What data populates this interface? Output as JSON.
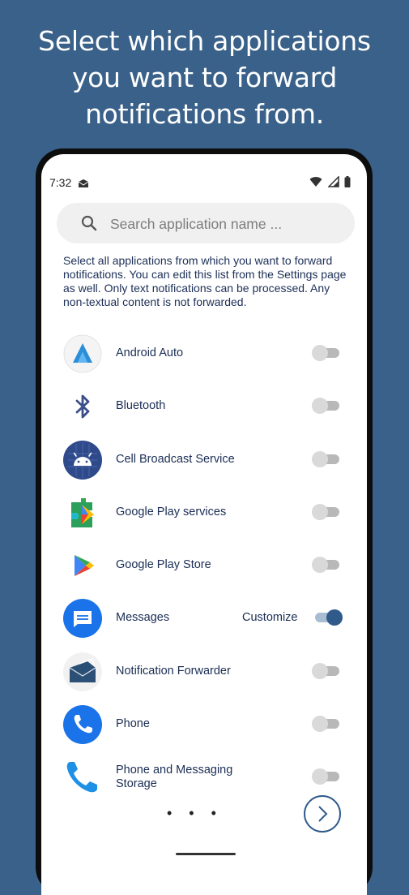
{
  "headline": {
    "line1": "Select which applications",
    "line2": "you want to forward",
    "line3": "notifications from."
  },
  "status_bar": {
    "time": "7:32",
    "icons": [
      "mail-icon",
      "wifi-icon",
      "signal-icon",
      "battery-icon"
    ]
  },
  "search": {
    "placeholder": "Search application name ..."
  },
  "description": "Select all applications from which you want to forward notifications. You can edit this list from the Settings page as well. Only text notifications can be processed. Any non-textual content is not forwarded.",
  "apps": [
    {
      "name": "Android Auto",
      "icon": "android-auto-icon",
      "enabled": false
    },
    {
      "name": "Bluetooth",
      "icon": "bluetooth-icon",
      "enabled": false
    },
    {
      "name": "Cell Broadcast Service",
      "icon": "android-robot-icon",
      "enabled": false
    },
    {
      "name": "Google Play services",
      "icon": "play-services-icon",
      "enabled": false
    },
    {
      "name": "Google Play Store",
      "icon": "play-store-icon",
      "enabled": false
    },
    {
      "name": "Messages",
      "icon": "messages-icon",
      "enabled": true,
      "action_label": "Customize"
    },
    {
      "name": "Notification Forwarder",
      "icon": "notification-forwarder-icon",
      "enabled": false
    },
    {
      "name": "Phone",
      "icon": "phone-icon",
      "enabled": false
    },
    {
      "name": "Phone and Messaging Storage",
      "icon": "phone-storage-icon",
      "enabled": false
    }
  ],
  "pagination": {
    "dots": "• • •"
  },
  "colors": {
    "background": "#3a6189",
    "accent": "#2f5a8a",
    "text": "#1a2d54"
  }
}
